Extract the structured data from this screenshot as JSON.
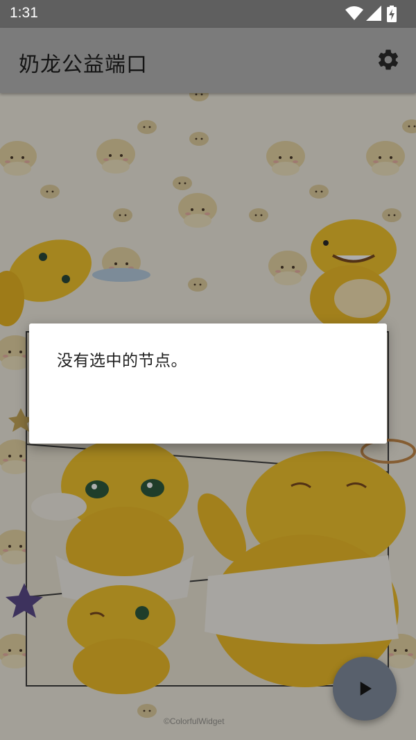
{
  "status_bar": {
    "time": "1:31",
    "icons": [
      "wifi-icon",
      "signal-icon",
      "battery-icon"
    ]
  },
  "app_bar": {
    "title": "奶龙公益端口",
    "settings_icon": "gear-icon"
  },
  "dialog": {
    "message": "没有选中的节点。"
  },
  "fab": {
    "icon": "play-icon"
  },
  "wallpaper": {
    "watermark": "©ColorfulWidget"
  },
  "colors": {
    "status_bar": "#5f5f5f",
    "app_bar": "#7b7b7b",
    "fab": "#58606c",
    "dialog": "#ffffff"
  }
}
